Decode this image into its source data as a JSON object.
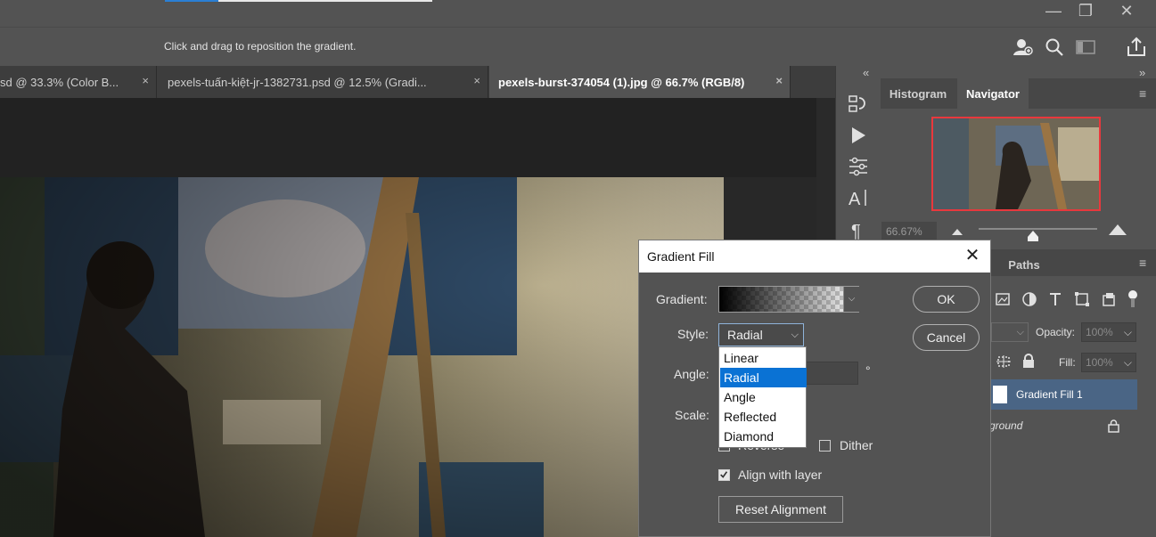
{
  "window": {
    "minimize_glyph": "—",
    "restore_glyph": "❐",
    "close_glyph": "✕"
  },
  "options_bar": {
    "hint": "Click and drag to reposition the gradient."
  },
  "tabs": [
    {
      "label": "sd @ 33.3% (Color B...",
      "close": "×",
      "active": false
    },
    {
      "label": "pexels-tuấn-kiệt-jr-1382731.psd @ 12.5% (Gradi...",
      "close": "×",
      "active": false
    },
    {
      "label": "pexels-burst-374054 (1).jpg @ 66.7% (RGB/8)",
      "close": "×",
      "active": true
    }
  ],
  "panels": {
    "collapse_left": "«",
    "collapse_right": "»",
    "top_tabs": [
      "Histogram",
      "Navigator"
    ],
    "active_top_tab": "Navigator",
    "zoom_value": "66.67%",
    "layers_tabs": [
      "Paths"
    ],
    "opacity_label": "Opacity:",
    "opacity_value": "100%",
    "fill_label": "Fill:",
    "fill_value": "100%",
    "layers": [
      {
        "name": "Gradient Fill 1",
        "selected": true
      },
      {
        "name": "ground",
        "locked": true
      }
    ]
  },
  "dialog": {
    "title": "Gradient Fill",
    "gradient_label": "Gradient:",
    "style_label": "Style:",
    "style_value": "Radial",
    "style_options": [
      "Linear",
      "Radial",
      "Angle",
      "Reflected",
      "Diamond"
    ],
    "selected_option": "Radial",
    "angle_label": "Angle:",
    "angle_unit": "°",
    "scale_label": "Scale:",
    "reverse_label": "Reverse",
    "reverse_checked": false,
    "dither_label": "Dither",
    "dither_checked": false,
    "align_label": "Align with layer",
    "align_checked": true,
    "reset_label": "Reset Alignment",
    "ok_label": "OK",
    "cancel_label": "Cancel"
  },
  "colors": {
    "accent": "#0a72d4",
    "navigator_frame": "#e8383d",
    "layer_selected": "#4a6585"
  }
}
